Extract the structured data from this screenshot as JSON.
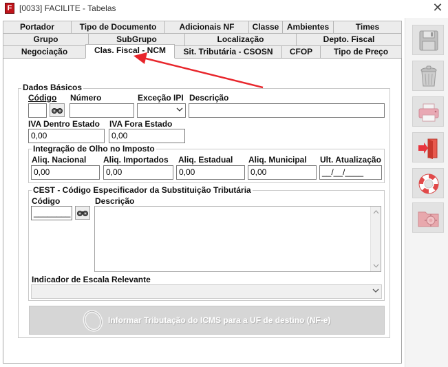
{
  "window": {
    "title": "[0033] FACILITE - Tabelas",
    "app_icon_letter": "F"
  },
  "tabs": {
    "row1": [
      "Portador",
      "Tipo de Documento",
      "Adicionais NF",
      "Classe",
      "Ambientes",
      "Times"
    ],
    "row2": [
      "Grupo",
      "SubGrupo",
      "Localização",
      "Depto. Fiscal"
    ],
    "row3": [
      "Negociação",
      "Clas. Fiscal - NCM",
      "Sit. Tributária - CSOSN",
      "CFOP",
      "Tipo de Preço"
    ],
    "active": "Clas. Fiscal - NCM"
  },
  "dados_basicos": {
    "legend": "Dados Básicos",
    "codigo_label": "Código",
    "numero_label": "Número",
    "excecao_label": "Exceção IPI",
    "descricao_label": "Descrição",
    "codigo_value": "",
    "numero_value": "",
    "excecao_value": "",
    "descricao_value": "",
    "iva_dentro_label": "IVA Dentro Estado",
    "iva_fora_label": "IVA Fora Estado",
    "iva_dentro_value": "0,00",
    "iva_fora_value": "0,00"
  },
  "olho_imposto": {
    "legend": "Integração de Olho no Imposto",
    "nacional_label": "Aliq. Nacional",
    "importados_label": "Aliq. Importados",
    "estadual_label": "Aliq. Estadual",
    "municipal_label": "Aliq. Municipal",
    "ult_atualizacao_label": "Ult. Atualização",
    "nacional_value": "0,00",
    "importados_value": "0,00",
    "estadual_value": "0,00",
    "municipal_value": "0,00",
    "ult_atualizacao_value": "__/__/____"
  },
  "cest": {
    "legend": "CEST - Código Especificador da Substituição Tributária",
    "codigo_label": "Código",
    "descricao_label": "Descrição",
    "codigo_value": "________",
    "descricao_value": "",
    "indicador_label": "Indicador de Escala Relevante",
    "indicador_value": ""
  },
  "icms_button": {
    "label": "Informar Tributação do ICMS para a UF de destino (NF-e)"
  },
  "colors": {
    "annotation_arrow": "#e8252b"
  }
}
